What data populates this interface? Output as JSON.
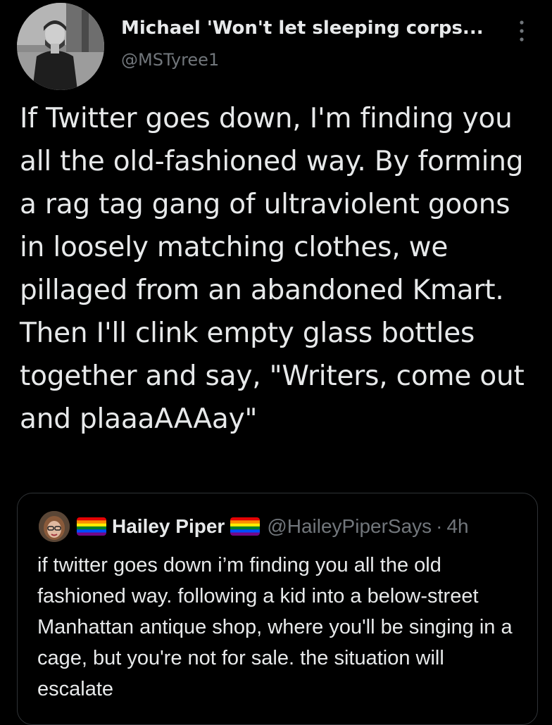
{
  "tweet": {
    "author": {
      "display_name": "Michael 'Won't let sleeping corps...",
      "handle": "@MSTyree1",
      "avatar_icon": "profile-photo"
    },
    "more_icon": "vertical-ellipsis",
    "text": "If Twitter goes down, I'm finding you all the old-fashioned way. By forming a rag tag gang of ultraviolent goons in loosely matching clothes, we pillaged from an abandoned Kmart. Then I'll clink empty glass bottles together and say, \"Writers, come out and plaaaAAAay\""
  },
  "quoted_tweet": {
    "author": {
      "display_name": "Hailey Piper",
      "handle": "@HaileyPiperSays",
      "avatar_icon": "profile-photo",
      "name_emoji": "rainbow-flag"
    },
    "separator": "·",
    "time": "4h",
    "text": "if twitter goes down i’m finding you all the old fashioned way. following a kid into a below-street Manhattan antique shop, where you'll be singing in a cage, but you're not for sale. the situation will escalate"
  },
  "colors": {
    "background": "#000000",
    "primary_text": "#e7e9ea",
    "secondary_text": "#71767b",
    "border": "#2f3336"
  }
}
